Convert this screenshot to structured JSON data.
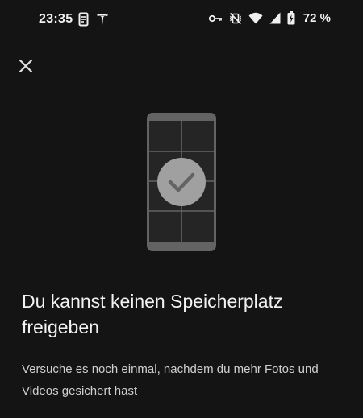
{
  "status_bar": {
    "time": "23:35",
    "left_icons": [
      "phone-clipboard-icon",
      "tesla-icon"
    ],
    "right_icons": [
      "vpn-key-icon",
      "vibrate-mute-icon",
      "wifi-icon",
      "cell-signal-icon",
      "battery-charging-icon"
    ],
    "battery_percent": "72 %"
  },
  "toolbar": {
    "close_icon": "close-icon"
  },
  "illustration": {
    "icon": "phone-check-illustration",
    "phone_color": "#636363",
    "check_color": "#636363",
    "check_circle_color": "#a0a0a0"
  },
  "message": {
    "title": "Du kannst keinen Speicherplatz freigeben",
    "body": "Versuche es noch einmal, nachdem du mehr Fotos und Videos gesichert hast"
  },
  "colors": {
    "background": "#141414",
    "text_primary": "#f2f2f2",
    "text_secondary": "#cfcfcf"
  }
}
